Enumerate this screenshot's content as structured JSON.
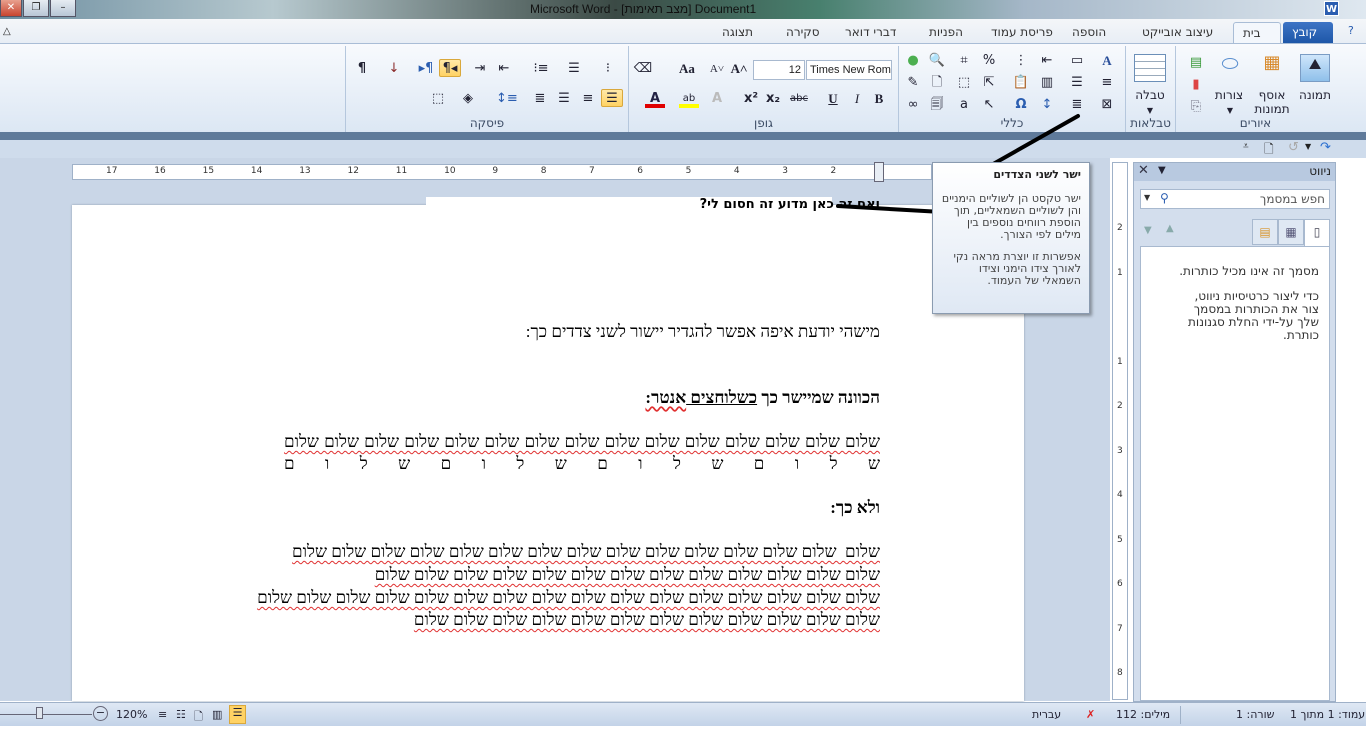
{
  "window": {
    "title": "Microsoft Word - [מצב תאימות] Document1",
    "app_icon": "W"
  },
  "tabs": [
    {
      "label": "קובץ"
    },
    {
      "label": "בית"
    },
    {
      "label": "עיצוב אובייקט"
    },
    {
      "label": "הוספה"
    },
    {
      "label": "פריסת עמוד"
    },
    {
      "label": "הפניות"
    },
    {
      "label": "דברי דואר"
    },
    {
      "label": "סקירה"
    },
    {
      "label": "תצוגה"
    }
  ],
  "ribbon": {
    "groups": {
      "illustrations": "איורים",
      "tables": "טבלאות",
      "general": "כללי",
      "font": "גופן",
      "paragraph": "פיסקה"
    },
    "picture": "תמונה",
    "clipart": "אוסף תמונות",
    "shapes": "צורות",
    "table": "טבלה",
    "font_name": "Times New Roma",
    "font_size": "12"
  },
  "rulers": {
    "horizontal": [
      "17",
      "16",
      "15",
      "14",
      "13",
      "12",
      "11",
      "10",
      "9",
      "8",
      "7",
      "6",
      "5",
      "4",
      "3",
      "2"
    ],
    "vertical": [
      "2",
      "1",
      "1",
      "2",
      "3",
      "4",
      "5",
      "6",
      "7",
      "8"
    ]
  },
  "document": {
    "selected_question": "ואם זה כאן מדוע זה חסום לי?",
    "line_question": "מישהי יודעת איפה אפשר להגדיר יישור לשני צדדים כך:",
    "heading1_a": "הכוונה שמיישר כך ",
    "heading1_b": "כשלוחצים ",
    "heading1_c": "אנטר:",
    "justified_line1": "שלום שלום שלום שלום שלום שלום שלום שלום שלום שלום שלום שלום שלום שלום שלום",
    "justified_line2": "ש ל ו ם ש ל ו ם ש ל ו ם ש ל ו ם",
    "heading2": "ולא כך:",
    "lines": [
      "שלום  שלום שלום שלום שלום שלום שלום שלום שלום שלום שלום שלום שלום שלום שלום",
      "שלום שלום שלום שלום שלום שלום שלום שלום שלום שלום שלום שלום שלום",
      "שלום שלום שלום שלום שלום שלום שלום שלום שלום שלום שלום שלום שלום שלום שלום שלום",
      "שלום שלום שלום שלום שלום שלום שלום שלום שלום שלום שלום שלום"
    ]
  },
  "tooltip": {
    "title": "ישר לשני הצדדים",
    "body1": "ישר טקסט הן לשוליים הימניים והן לשוליים השמאליים, תוך הוספת רווחים נוספים בין מילים לפי הצורך.",
    "body2": "אפשרות זו יוצרת מראה נקי לאורך צידו הימני וצידו השמאלי של העמוד."
  },
  "nav_pane": {
    "title": "ניווט",
    "search_placeholder": "חפש במסמך",
    "message1": "מסמך זה אינו מכיל כותרות.",
    "message2": "כדי ליצור כרטיסיות ניווט, צור את הכותרות במסמך שלך על-ידי החלת סגנונות כותרת."
  },
  "status_bar": {
    "page": "עמוד: 1 מתוך 1",
    "line": "שורה: 1",
    "words": "מילים: 112",
    "language": "עברית",
    "zoom": "120%"
  },
  "colors": {
    "accent": "#1e57a8",
    "active_button": "#ffd264",
    "font_color": "#e00000",
    "highlight": "#ffff00"
  }
}
